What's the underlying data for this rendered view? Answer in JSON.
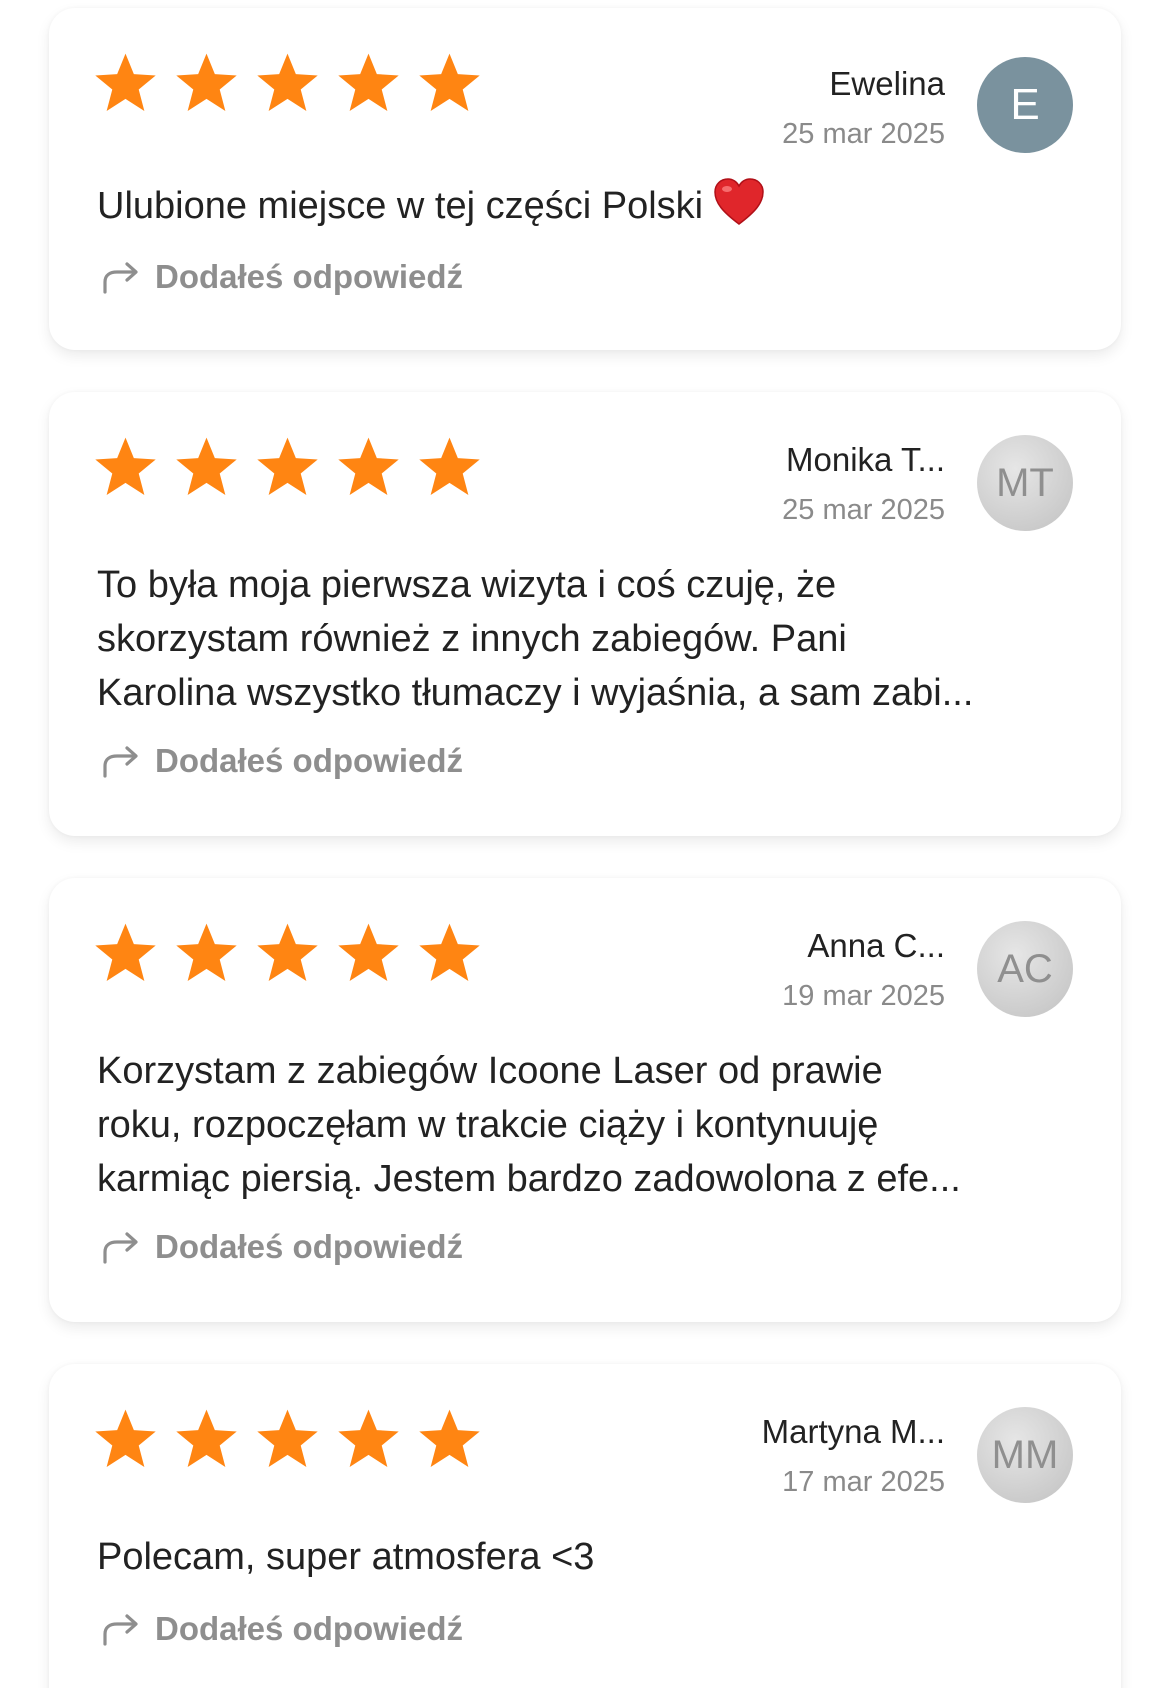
{
  "colors": {
    "star": "#ff8512",
    "avatar_e": "#7a929e",
    "avatar_grey": "#cccccc",
    "muted_text": "#8a8a8a"
  },
  "reviews": [
    {
      "author": "Ewelina",
      "date": "25 mar 2025",
      "initials": "E",
      "rating": 5,
      "text": "Ulubione miejsce w tej części Polski",
      "emoji": "heart-icon",
      "reply_label": "Dodałeś odpowiedź"
    },
    {
      "author": "Monika T...",
      "date": "25 mar 2025",
      "initials": "MT",
      "rating": 5,
      "text_lines": [
        "To była moja pierwsza wizyta i coś czuję, że",
        "skorzystam również z innych zabiegów. Pani",
        "Karolina wszystko tłumaczy i wyjaśnia, a sam zabi..."
      ],
      "reply_label": "Dodałeś odpowiedź"
    },
    {
      "author": "Anna C...",
      "date": "19 mar 2025",
      "initials": "AC",
      "rating": 5,
      "text_lines": [
        "Korzystam z zabiegów Icoone Laser od prawie",
        "roku, rozpoczęłam w trakcie ciąży i kontynuuję",
        "karmiąc piersią. Jestem bardzo zadowolona z efe..."
      ],
      "reply_label": "Dodałeś odpowiedź"
    },
    {
      "author": "Martyna M...",
      "date": "17 mar 2025",
      "initials": "MM",
      "rating": 5,
      "text": "Polecam, super atmosfera <3",
      "reply_label": "Dodałeś odpowiedź"
    }
  ]
}
